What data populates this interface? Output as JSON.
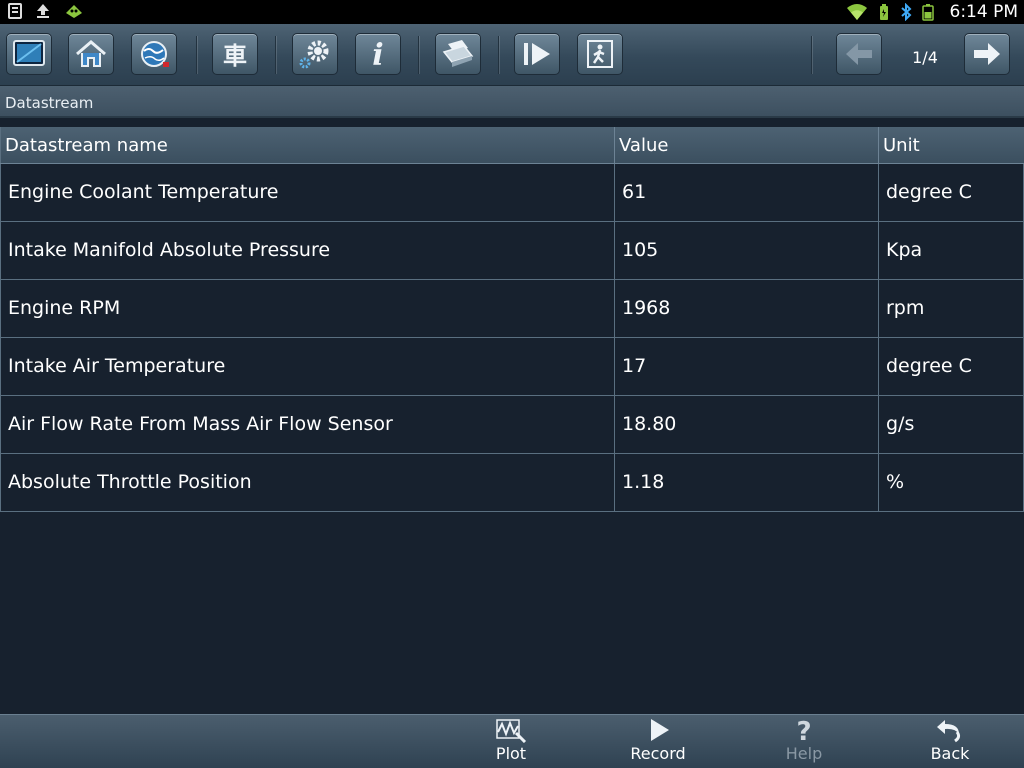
{
  "status_bar": {
    "left_icons": [
      "sd-card-icon",
      "upload-icon",
      "android-debug-icon"
    ],
    "right_icons": [
      "wifi-icon",
      "battery-saver-icon",
      "bluetooth-icon",
      "battery-icon"
    ],
    "time": "6:14 PM"
  },
  "toolbar": {
    "buttons": [
      {
        "icon": "screen-icon"
      },
      {
        "icon": "home-icon"
      },
      {
        "icon": "globe-icon"
      },
      {
        "icon": "vehicle-icon"
      },
      {
        "icon": "settings-icon"
      },
      {
        "icon": "info-icon"
      },
      {
        "icon": "print-icon"
      },
      {
        "icon": "play-icon"
      },
      {
        "icon": "exit-icon"
      }
    ],
    "page_indicator": "1/4",
    "prev_icon": "arrow-left-icon",
    "next_icon": "arrow-right-icon"
  },
  "breadcrumb": "Datastream",
  "table": {
    "headers": [
      "Datastream name",
      "Value",
      "Unit"
    ],
    "rows": [
      {
        "name": "Engine Coolant Temperature",
        "value": "61",
        "unit": "degree C"
      },
      {
        "name": "Intake Manifold Absolute Pressure",
        "value": "105",
        "unit": "Kpa"
      },
      {
        "name": "Engine RPM",
        "value": "1968",
        "unit": "rpm"
      },
      {
        "name": "Intake Air Temperature",
        "value": "17",
        "unit": "degree C"
      },
      {
        "name": "Air Flow Rate From Mass Air Flow Sensor",
        "value": "18.80",
        "unit": "g/s"
      },
      {
        "name": "Absolute Throttle Position",
        "value": "1.18",
        "unit": "%"
      }
    ]
  },
  "bottom_bar": {
    "buttons": [
      {
        "label": "Plot",
        "icon": "plot-icon",
        "enabled": true
      },
      {
        "label": "Record",
        "icon": "record-icon",
        "enabled": true
      },
      {
        "label": "Help",
        "icon": "help-icon",
        "enabled": false
      },
      {
        "label": "Back",
        "icon": "back-icon",
        "enabled": true
      }
    ]
  },
  "colors": {
    "background": "#17212e",
    "toolbar": "#3f5666",
    "accent": "#3fa9f5"
  }
}
